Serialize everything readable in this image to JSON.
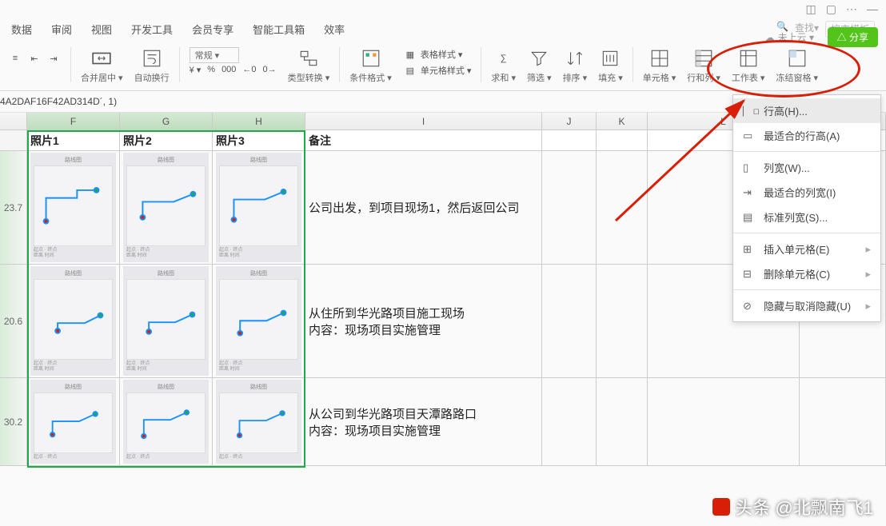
{
  "titlebar": {
    "dash": "—"
  },
  "menubar": {
    "items": [
      "数据",
      "审阅",
      "视图",
      "开发工具",
      "会员专享",
      "智能工具箱",
      "效率"
    ],
    "search_label": "查找▾",
    "search_placeholder": "搜索模板"
  },
  "sync": {
    "label": "未上云 ▾"
  },
  "share": {
    "label": "分享"
  },
  "ribbon": {
    "merge": "合并居中 ▾",
    "wrap": "自动换行",
    "general": "常规 ▾",
    "yen": "¥ ▾",
    "pct": "%",
    "dec": "000",
    "dec_inc": "←0",
    "dec_dec": "0→",
    "type_convert": "类型转换 ▾",
    "cond_fmt": "条件格式 ▾",
    "table_style": "表格样式 ▾",
    "cell_style": "单元格样式 ▾",
    "sum": "求和 ▾",
    "filter": "筛选 ▾",
    "sort": "排序 ▾",
    "fill": "填充 ▾",
    "cell": "单元格 ▾",
    "rowcol": "行和列 ▾",
    "sheet": "工作表 ▾",
    "freeze": "冻结窗格 ▾"
  },
  "formula": "4A2DAF16F42AD314D´, 1)",
  "columns": {
    "F": "F",
    "G": "G",
    "H": "H",
    "I": "I",
    "J": "J",
    "K": "K",
    "L": "L"
  },
  "headers": {
    "F": "照片1",
    "G": "照片2",
    "H": "照片3",
    "I": "备注"
  },
  "rows": [
    {
      "stub": "23.7",
      "remark": "公司出发，到项目现场1，然后返回公司"
    },
    {
      "stub": "20.6",
      "remark": "从住所到华光路项目施工现场\n内容：现场项目实施管理"
    },
    {
      "stub": "30.2",
      "remark": "从公司到华光路项目天潭路路口\n内容：现场项目实施管理"
    }
  ],
  "dropdown": {
    "row_height": "行高(H)...",
    "fit_row": "最适合的行高(A)",
    "col_width": "列宽(W)...",
    "fit_col": "最适合的列宽(I)",
    "std_width": "标准列宽(S)...",
    "insert_cell": "插入单元格(E)",
    "delete_cell": "删除单元格(C)",
    "hide_unhide": "隐藏与取消隐藏(U)"
  },
  "watermark": "头条 @北飘南飞1"
}
